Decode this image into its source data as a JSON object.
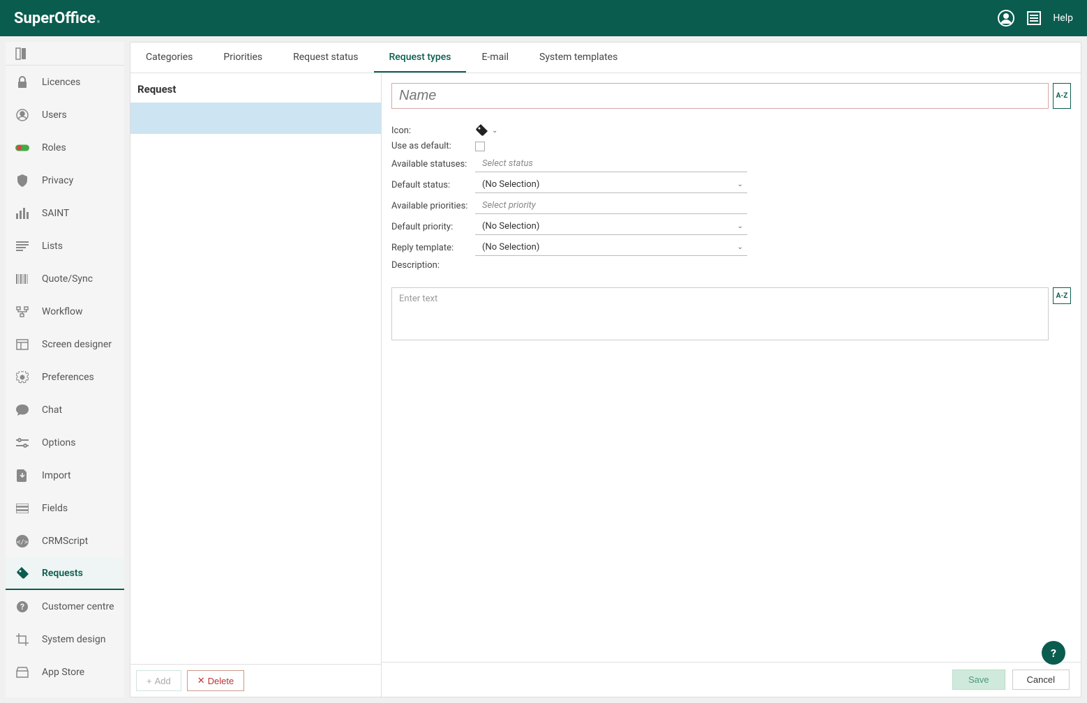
{
  "brand": "SuperOffice",
  "topbar": {
    "help": "Help"
  },
  "sidebar": {
    "items": [
      {
        "label": "Licences"
      },
      {
        "label": "Users"
      },
      {
        "label": "Roles"
      },
      {
        "label": "Privacy"
      },
      {
        "label": "SAINT"
      },
      {
        "label": "Lists"
      },
      {
        "label": "Quote/Sync"
      },
      {
        "label": "Workflow"
      },
      {
        "label": "Screen designer"
      },
      {
        "label": "Preferences"
      },
      {
        "label": "Chat"
      },
      {
        "label": "Options"
      },
      {
        "label": "Import"
      },
      {
        "label": "Fields"
      },
      {
        "label": "CRMScript"
      },
      {
        "label": "Requests"
      },
      {
        "label": "Customer centre"
      },
      {
        "label": "System design"
      },
      {
        "label": "App Store"
      }
    ]
  },
  "tabs": [
    {
      "label": "Categories"
    },
    {
      "label": "Priorities"
    },
    {
      "label": "Request status"
    },
    {
      "label": "Request types"
    },
    {
      "label": "E-mail"
    },
    {
      "label": "System templates"
    }
  ],
  "leftPanel": {
    "title": "Request"
  },
  "form": {
    "name_placeholder": "Name",
    "az": "A-Z",
    "labels": {
      "icon": "Icon:",
      "use_default": "Use as default:",
      "avail_statuses": "Available statuses:",
      "default_status": "Default status:",
      "avail_priorities": "Available priorities:",
      "default_priority": "Default priority:",
      "reply_template": "Reply template:",
      "description": "Description:"
    },
    "values": {
      "avail_statuses_placeholder": "Select status",
      "default_status": "(No Selection)",
      "avail_priorities_placeholder": "Select priority",
      "default_priority": "(No Selection)",
      "reply_template": "(No Selection)",
      "desc_placeholder": "Enter text"
    }
  },
  "buttons": {
    "add": "Add",
    "delete": "Delete",
    "save": "Save",
    "cancel": "Cancel"
  },
  "fab": "?"
}
